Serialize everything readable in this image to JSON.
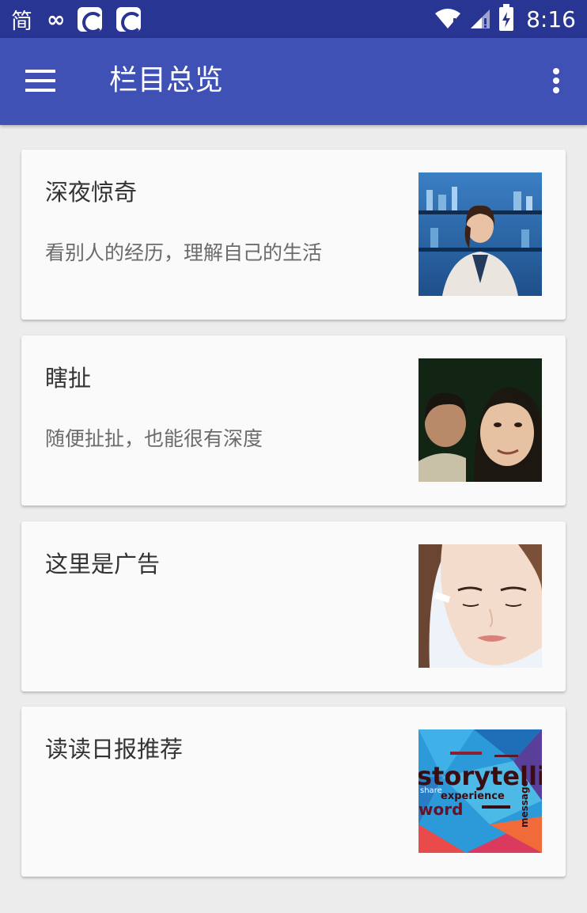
{
  "status_bar": {
    "input_method": "简",
    "infinity": "∞",
    "time": "8:16",
    "bg_color": "#283593"
  },
  "app_bar": {
    "title": "栏目总览",
    "menu_icon": "hamburger-menu-icon",
    "overflow_icon": "more-vert-icon",
    "bg_color": "#3f51b5"
  },
  "cards": [
    {
      "title": "深夜惊奇",
      "description": "看别人的经历，理解自己的生活",
      "image": "woman-lab-coat-photo"
    },
    {
      "title": "瞎扯",
      "description": "随便扯扯，也能很有深度",
      "image": "two-people-photo"
    },
    {
      "title": "这里是广告",
      "description": "",
      "image": "woman-face-cream-photo"
    },
    {
      "title": "读读日报推荐",
      "description": "",
      "image": "storytelling-word-cloud-image"
    }
  ],
  "storytelling_words": {
    "main": "storytelling",
    "word1": "experience",
    "word2": "word",
    "word3": "share",
    "word4": "message"
  }
}
